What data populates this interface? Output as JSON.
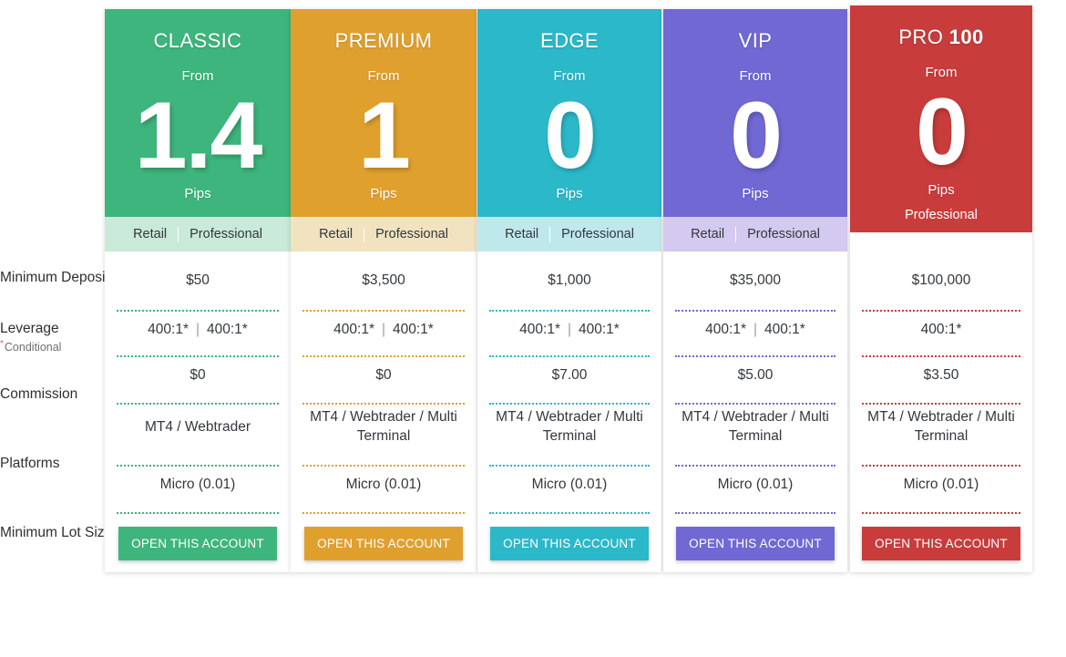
{
  "row_labels": [
    {
      "main": "Minimum Deposit",
      "sub": null
    },
    {
      "main": "Leverage",
      "sub": "Conditional",
      "sub_marker": "*"
    },
    {
      "main": "Commission",
      "sub": null
    },
    {
      "main": "Platforms",
      "sub": null
    },
    {
      "main": "Minimum Lot Size",
      "sub": null
    }
  ],
  "labels": {
    "from": "From",
    "pips": "Pips",
    "retail": "Retail",
    "professional": "Professional",
    "divider": "|",
    "cta": "OPEN THIS ACCOUNT"
  },
  "columns": [
    {
      "name": "CLASSIC",
      "name_prefix": "CLASSIC",
      "name_suffix": "",
      "color": "#3eb57c",
      "tint": "#c9ead8",
      "dots": "#3eb57c",
      "from": "From",
      "spread": "1.4",
      "pips": "Pips",
      "audience": [
        "Retail",
        "Professional"
      ],
      "audience_solid": false,
      "featured": false,
      "minimum_deposit": "$50",
      "leverage": [
        "400:1*",
        "400:1*"
      ],
      "commission": "$0",
      "platforms": "MT4 / Webtrader",
      "minimum_lot_size": "Micro (0.01)",
      "cta": "OPEN THIS ACCOUNT"
    },
    {
      "name": "PREMIUM",
      "name_prefix": "PREMIUM",
      "name_suffix": "",
      "color": "#e0a02e",
      "tint": "#f1e2c0",
      "dots": "#e0a02e",
      "from": "From",
      "spread": "1",
      "pips": "Pips",
      "audience": [
        "Retail",
        "Professional"
      ],
      "audience_solid": false,
      "featured": false,
      "minimum_deposit": "$3,500",
      "leverage": [
        "400:1*",
        "400:1*"
      ],
      "commission": "$0",
      "platforms": "MT4 / Webtrader / Multi Terminal",
      "minimum_lot_size": "Micro (0.01)",
      "cta": "OPEN THIS ACCOUNT"
    },
    {
      "name": "EDGE",
      "name_prefix": "EDGE",
      "name_suffix": "",
      "color": "#2bb8c9",
      "tint": "#bfe8ec",
      "dots": "#2bb8c9",
      "from": "From",
      "spread": "0",
      "pips": "Pips",
      "audience": [
        "Retail",
        "Professional"
      ],
      "audience_solid": false,
      "featured": false,
      "minimum_deposit": "$1,000",
      "leverage": [
        "400:1*",
        "400:1*"
      ],
      "commission": "$7.00",
      "platforms": "MT4 / Webtrader / Multi Terminal",
      "minimum_lot_size": "Micro (0.01)",
      "cta": "OPEN THIS ACCOUNT"
    },
    {
      "name": "VIP",
      "name_prefix": "VIP",
      "name_suffix": "",
      "color": "#7168d4",
      "tint": "#d4c9ee",
      "dots": "#7168d4",
      "from": "From",
      "spread": "0",
      "pips": "Pips",
      "audience": [
        "Retail",
        "Professional"
      ],
      "audience_solid": false,
      "featured": false,
      "minimum_deposit": "$35,000",
      "leverage": [
        "400:1*",
        "400:1*"
      ],
      "commission": "$5.00",
      "platforms": "MT4 / Webtrader / Multi Terminal",
      "minimum_lot_size": "Micro (0.01)",
      "cta": "OPEN THIS ACCOUNT"
    },
    {
      "name": "PRO 100",
      "name_prefix": "PRO ",
      "name_suffix": "100",
      "color": "#c83c3c",
      "tint": "#c83c3c",
      "dots": "#c83c3c",
      "from": "From",
      "spread": "0",
      "pips": "Pips",
      "audience": [
        "Professional"
      ],
      "audience_solid": true,
      "featured": true,
      "minimum_deposit": "$100,000",
      "leverage": [
        "400:1*"
      ],
      "commission": "$3.50",
      "platforms": "MT4 / Webtrader / Multi Terminal",
      "minimum_lot_size": "Micro (0.01)",
      "cta": "OPEN THIS ACCOUNT"
    }
  ]
}
